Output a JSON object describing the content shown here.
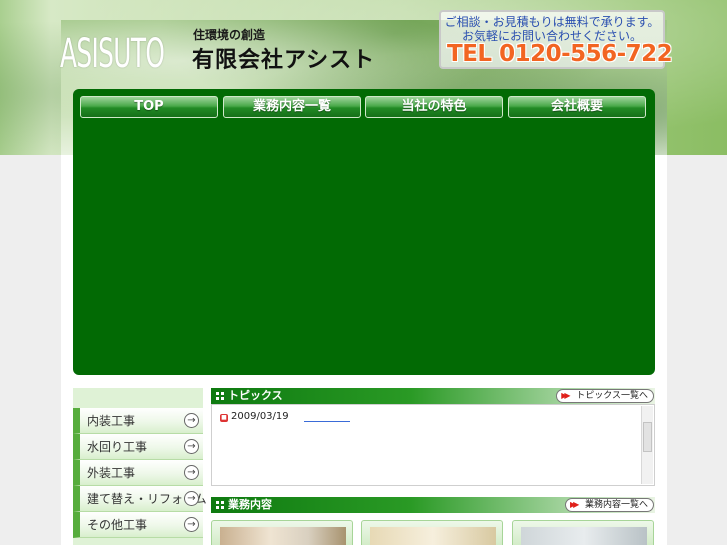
{
  "header": {
    "logo_text": "ASISUTO",
    "tagline": "住環境の創造",
    "company_name": "有限会社アシスト",
    "contact_line1": "ご相談・お見積もりは無料で承ります。",
    "contact_line2": "お気軽にお問い合わせください。",
    "tel": "TEL 0120-556-722"
  },
  "nav": {
    "items": [
      {
        "label": "TOP"
      },
      {
        "label": "業務内容一覧"
      },
      {
        "label": "当社の特色"
      },
      {
        "label": "会社概要"
      }
    ]
  },
  "sidebar": {
    "items": [
      {
        "label": "内装工事"
      },
      {
        "label": "水回り工事"
      },
      {
        "label": "外装工事"
      },
      {
        "label": "建て替え・リフォーム"
      },
      {
        "label": "その他工事"
      }
    ],
    "arrow_icon": "arrow-right-circle-icon"
  },
  "topics": {
    "title": "トピックス",
    "more_label": "トピックス一覧へ",
    "entries": [
      {
        "date": "2009/03/19"
      }
    ]
  },
  "services": {
    "title": "業務内容",
    "more_label": "業務内容一覧へ"
  },
  "colors": {
    "main_green": "#026a04",
    "tel_orange": "#f26522",
    "contact_blue": "#2a4fb0",
    "accent_red": "#e0201a"
  }
}
